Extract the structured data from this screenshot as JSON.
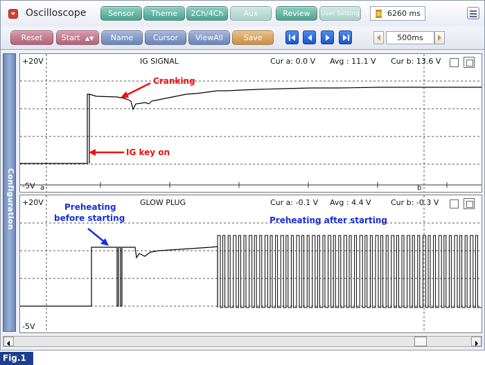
{
  "app": {
    "title": "Oscilloscope",
    "time_display": "6260 ms"
  },
  "toolbar_top": [
    {
      "label": "Sensor"
    },
    {
      "label": "Theme"
    },
    {
      "label": "2Ch/4Ch"
    },
    {
      "label": "Aux"
    },
    {
      "label": "Review"
    },
    {
      "label": "User Setting"
    }
  ],
  "toolbar_bottom": {
    "reset": "Reset",
    "start": "Start",
    "name": "Name",
    "cursor": "Cursor",
    "view_all": "ViewAll",
    "save": "Save",
    "interval": "500ms"
  },
  "side_tab": "Configuration",
  "channels": [
    {
      "name": "IG SIGNAL",
      "y_max": "+20V",
      "y_min": "-5V",
      "cur_a": "Cur a: 0.0 V",
      "avg": "Avg : 11.1 V",
      "cur_b": "Cur b: 13.6 V",
      "cursor_a": "a",
      "cursor_b": "b",
      "color": "#000000"
    },
    {
      "name": "GLOW PLUG",
      "y_max": "+20V",
      "y_min": "-5V",
      "cur_a": "Cur a: -0.1 V",
      "avg": "Avg : 4.4 V",
      "cur_b": "Cur b: -0.3 V",
      "color": "#000000"
    }
  ],
  "annotations": {
    "cranking": "Cranking",
    "ig_key_on": "IG key on",
    "preheat_before_1": "Preheating",
    "preheat_before_2": "before starting",
    "preheat_after": "Preheating after starting"
  },
  "colors": {
    "annotation_red": "#ee1111",
    "annotation_blue": "#1a2fd6",
    "trace": "#000000"
  },
  "figure_label": "Fig.1"
}
